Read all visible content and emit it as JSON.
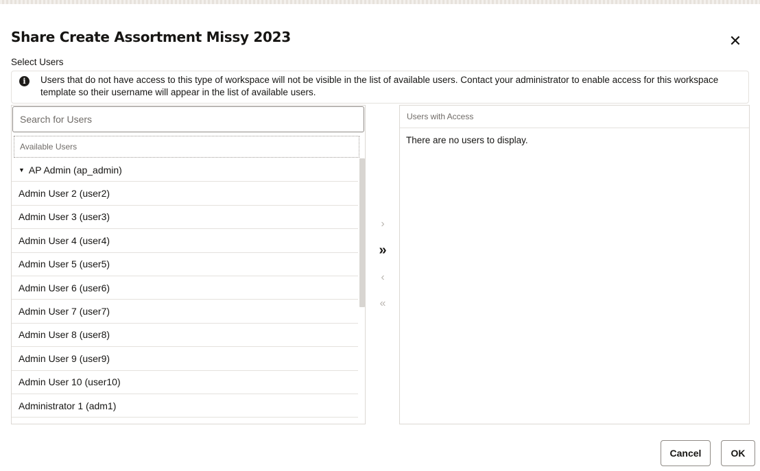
{
  "dialog": {
    "title": "Share Create Assortment Missy 2023",
    "close_icon": "close-icon"
  },
  "select_users_label": "Select Users",
  "info": {
    "icon": "info-icon",
    "message": "Users that do not have access to this type of workspace will not be visible in the list of available users. Contact your administrator to enable access for this workspace template so their username will appear in the list of available users."
  },
  "available": {
    "search_placeholder": "Search for Users",
    "header": "Available Users",
    "users": [
      "AP Admin (ap_admin)",
      "Admin User 2 (user2)",
      "Admin User 3 (user3)",
      "Admin User 4 (user4)",
      "Admin User 5 (user5)",
      "Admin User 6 (user6)",
      "Admin User 7 (user7)",
      "Admin User 8 (user8)",
      "Admin User 9 (user9)",
      "Admin User 10 (user10)",
      "Administrator 1 (adm1)"
    ]
  },
  "shuttle": {
    "move_selected": "›",
    "move_all": "»",
    "remove_selected": "‹",
    "remove_all": "«"
  },
  "access": {
    "header": "Users with Access",
    "empty_message": "There are no users to display."
  },
  "footer": {
    "cancel_label": "Cancel",
    "ok_label": "OK"
  }
}
